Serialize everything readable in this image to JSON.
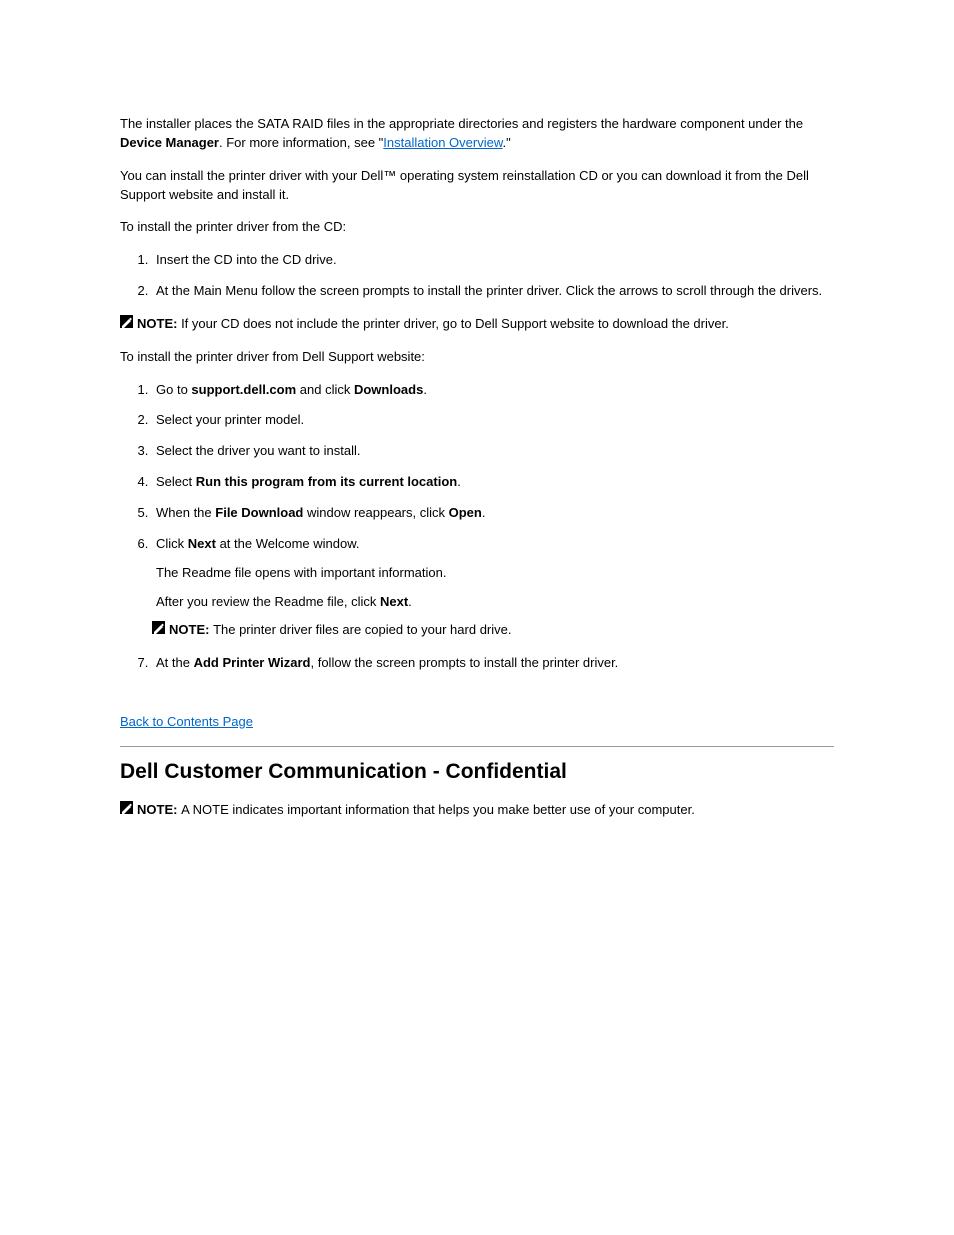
{
  "intro": {
    "p1_a": "The installer places the SATA RAID files in the appropriate directories and registers the hardware component under the ",
    "p1_b": "Device Manager",
    "p1_c": ". For more information, see \"",
    "p1_link": "Installation Overview",
    "p1_d": ".\"",
    "p2": "You can install the printer driver with your Dell™ operating system reinstallation CD or you can download it from the Dell Support website and install it."
  },
  "cdInstall": {
    "heading": "To install the printer driver from the CD:",
    "steps": [
      "Insert the CD into the CD drive.",
      "At the Main Menu follow the screen prompts to install the printer driver. Click the arrows to scroll through the drivers."
    ],
    "note": "If your CD does not include the printer driver, go to Dell Support website to download the driver."
  },
  "webInstall": {
    "heading": "To install the printer driver from Dell Support website:",
    "steps": [
      {
        "a": "Go to ",
        "b": "support.dell.com",
        "c": " and click ",
        "d": "Downloads",
        "e": "."
      },
      "Select your printer model.",
      "Select the driver you want to install.",
      {
        "a": "Select ",
        "b": "Run this program from its current location",
        "c": "."
      },
      {
        "a": "When the ",
        "b": "File Download",
        "c": " window reappears, click ",
        "d": "Open",
        "e": "."
      },
      {
        "a": "Click ",
        "b": "Next",
        "c": " at the Welcome window.",
        "sub_a": "The Readme file opens with important information.",
        "sub_b": "After you review the Readme file, click ",
        "sub_c": "Next",
        "sub_d": ".",
        "subnote_label": "NOTE: ",
        "subnote_text": "The printer driver files are copied to your hard drive."
      },
      {
        "a": "At the ",
        "b": "Add Printer Wizard",
        "c": ", follow the screen prompts to install the printer driver."
      }
    ]
  },
  "back": {
    "prefix": "",
    "link": "Back to Contents Page"
  },
  "section2": {
    "title": "Dell Customer Communication - Confidential",
    "note_label": "NOTE: ",
    "note_text": "A NOTE indicates important information that helps you make better use of your computer."
  }
}
